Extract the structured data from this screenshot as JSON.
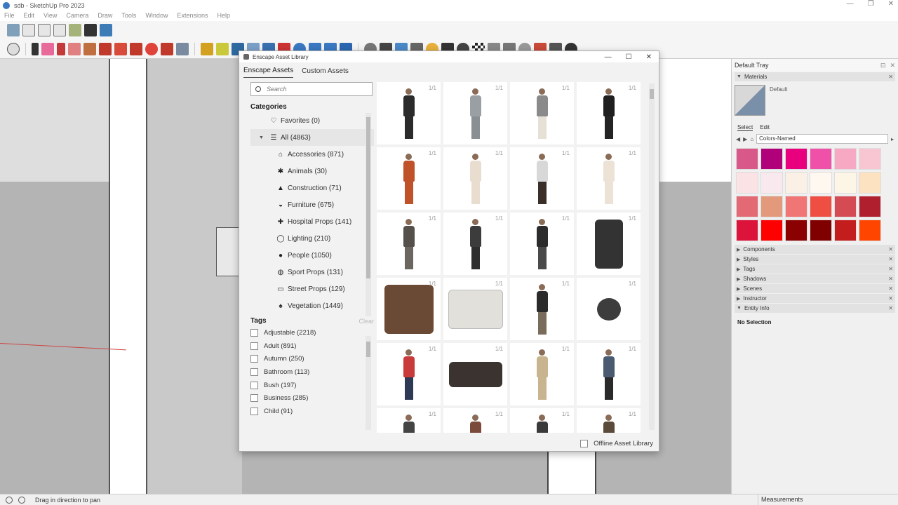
{
  "window": {
    "title": "sdb - SketchUp Pro 2023",
    "controls": [
      "—",
      "❐",
      "✕"
    ]
  },
  "menu": [
    "File",
    "Edit",
    "View",
    "Camera",
    "Draw",
    "Tools",
    "Window",
    "Extensions",
    "Help"
  ],
  "dialog": {
    "title": "Enscape Asset Library",
    "controls": [
      "—",
      "☐",
      "✕"
    ],
    "tabs": [
      "Enscape Assets",
      "Custom Assets"
    ],
    "search_placeholder": "Search",
    "categories_heading": "Categories",
    "favorites": "Favorites (0)",
    "all": "All (4863)",
    "categories": [
      {
        "label": "Accessories (871)",
        "icon": "accessories-icon",
        "glyph": "⌂"
      },
      {
        "label": "Animals (30)",
        "icon": "paw-icon",
        "glyph": "✱"
      },
      {
        "label": "Construction (71)",
        "icon": "cone-icon",
        "glyph": "▲"
      },
      {
        "label": "Furniture (675)",
        "icon": "chair-icon",
        "glyph": "◒"
      },
      {
        "label": "Hospital Props (141)",
        "icon": "medical-icon",
        "glyph": "✚"
      },
      {
        "label": "Lighting (210)",
        "icon": "bulb-icon",
        "glyph": "◯"
      },
      {
        "label": "People (1050)",
        "icon": "people-icon",
        "glyph": "●"
      },
      {
        "label": "Sport Props (131)",
        "icon": "whistle-icon",
        "glyph": "◍"
      },
      {
        "label": "Street Props (129)",
        "icon": "street-icon",
        "glyph": "▭"
      },
      {
        "label": "Vegetation (1449)",
        "icon": "leaf-icon",
        "glyph": "♠"
      }
    ],
    "tags_heading": "Tags",
    "tags_clear": "Clear",
    "tags": [
      "Adjustable (2218)",
      "Adult (891)",
      "Autumn (250)",
      "Bathroom (113)",
      "Bush (197)",
      "Business (285)",
      "Child (91)"
    ],
    "asset_count_label": "1/1",
    "assets": [
      {
        "kind": "person",
        "top": "#2b2b2b",
        "bottom": "#2b2b2b"
      },
      {
        "kind": "person",
        "top": "#9a9fa3",
        "bottom": "#8a8f94"
      },
      {
        "kind": "person",
        "top": "#8a8a8a",
        "bottom": "#e6e0d6"
      },
      {
        "kind": "person",
        "top": "#1f1f1f",
        "bottom": "#242424"
      },
      {
        "kind": "person",
        "top": "#c0522a",
        "bottom": "#c0522a"
      },
      {
        "kind": "person",
        "top": "#e9ddd0",
        "bottom": "#e9ddd0"
      },
      {
        "kind": "person",
        "top": "#d8d8d8",
        "bottom": "#3a2e28"
      },
      {
        "kind": "person",
        "top": "#ece2d6",
        "bottom": "#ece2d6"
      },
      {
        "kind": "person",
        "top": "#55504a",
        "bottom": "#6b6660"
      },
      {
        "kind": "person",
        "top": "#3c3c3c",
        "bottom": "#2e2e2e"
      },
      {
        "kind": "person",
        "top": "#2c2c2c",
        "bottom": "#4a4a4a"
      },
      {
        "kind": "machine",
        "top": "#333333",
        "bottom": "#555555"
      },
      {
        "kind": "cube",
        "top": "#6b4a35",
        "bottom": "#6b4a35"
      },
      {
        "kind": "cushion",
        "top": "#e2e0da",
        "bottom": "#e2e0da"
      },
      {
        "kind": "person",
        "top": "#2b2b2b",
        "bottom": "#7a6c5a"
      },
      {
        "kind": "roller",
        "top": "#3d3d3d",
        "bottom": "#3d3d3d"
      },
      {
        "kind": "person",
        "top": "#c93a3a",
        "bottom": "#2e3a55"
      },
      {
        "kind": "step",
        "top": "#3a3330",
        "bottom": "#3a3330"
      },
      {
        "kind": "person",
        "top": "#c8b48e",
        "bottom": "#c8b48e"
      },
      {
        "kind": "person",
        "top": "#4a5a70",
        "bottom": "#2a2a2a"
      },
      {
        "kind": "person",
        "top": "#444444",
        "bottom": "#444444"
      },
      {
        "kind": "person",
        "top": "#7a4a3a",
        "bottom": "#7a4a3a"
      },
      {
        "kind": "person",
        "top": "#3a3a3a",
        "bottom": "#3a3a3a"
      },
      {
        "kind": "person",
        "top": "#5a4a3a",
        "bottom": "#5a4a3a"
      }
    ],
    "offline_label": "Offline Asset Library"
  },
  "tray": {
    "title": "Default Tray",
    "materials_label": "Materials",
    "material_name": "Default",
    "select_tab": "Select",
    "edit_tab": "Edit",
    "library": "Colors-Named",
    "swatches": [
      "#d9588a",
      "#b0007a",
      "#e8007e",
      "#f051a8",
      "#f7a8c3",
      "#f8c6d2",
      "#fbe2e4",
      "#f9e9ef",
      "#faf0e6",
      "#fff8f0",
      "#fdf5e6",
      "#fde2c2",
      "#e36a75",
      "#e39a7c",
      "#f07575",
      "#ef4e43",
      "#d44b54",
      "#b01f2e",
      "#dc143c",
      "#ff0000",
      "#8b0000",
      "#800000",
      "#c31d1d",
      "#ff4500"
    ],
    "sections": [
      "Components",
      "Styles",
      "Tags",
      "Shadows",
      "Scenes",
      "Instructor",
      "Entity Info"
    ],
    "entity_info_value": "No Selection"
  },
  "status": {
    "hint": "Drag in direction to pan",
    "measurements_label": "Measurements"
  }
}
